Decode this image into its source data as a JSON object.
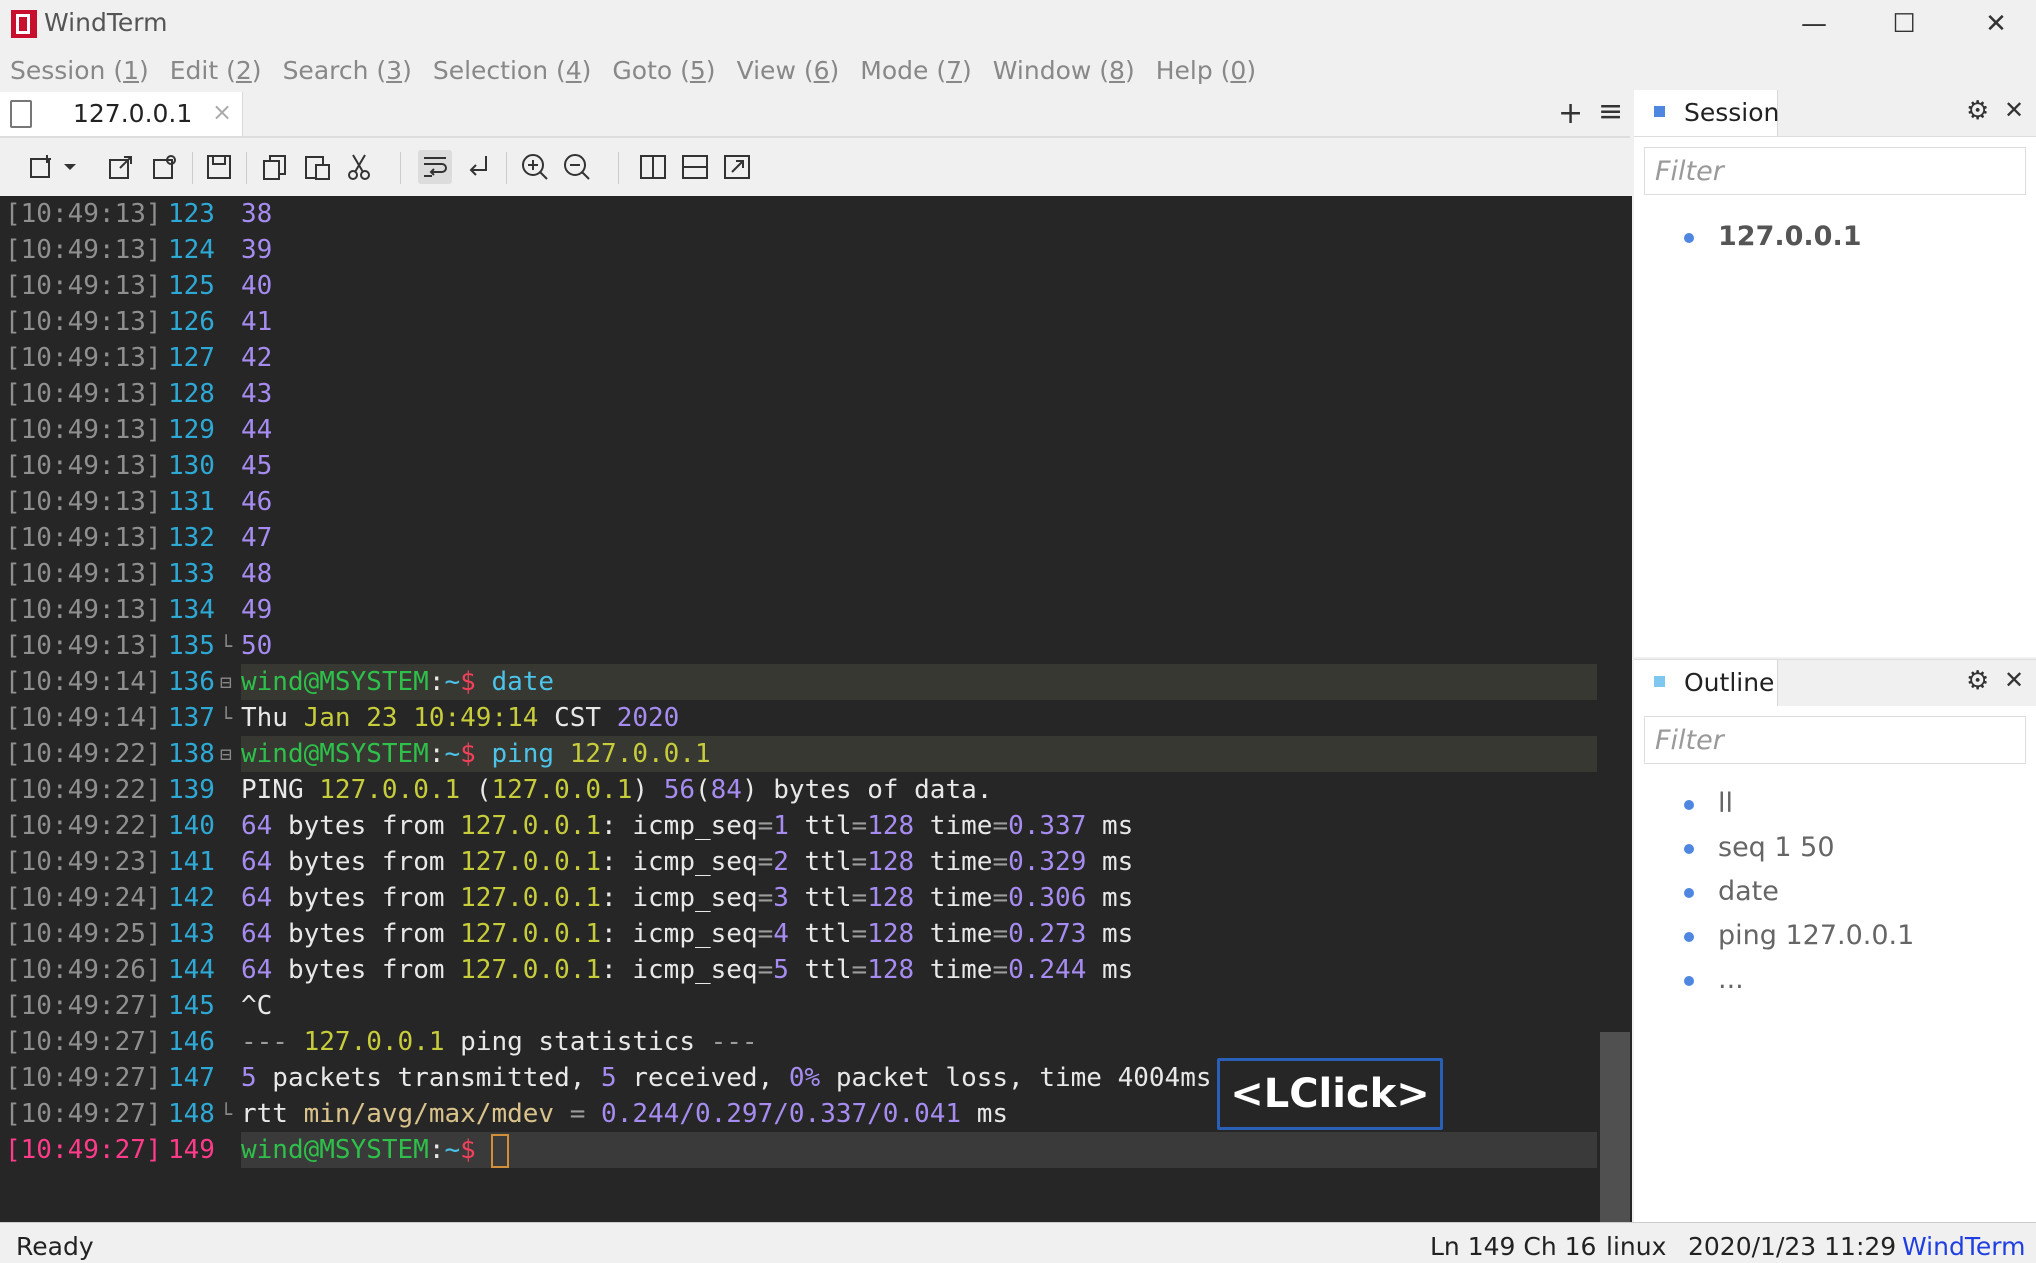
{
  "window": {
    "title": "WindTerm"
  },
  "menu": [
    {
      "label": "Session",
      "key": "1"
    },
    {
      "label": "Edit",
      "key": "2"
    },
    {
      "label": "Search",
      "key": "3"
    },
    {
      "label": "Selection",
      "key": "4"
    },
    {
      "label": "Goto",
      "key": "5"
    },
    {
      "label": "View",
      "key": "6"
    },
    {
      "label": "Mode",
      "key": "7"
    },
    {
      "label": "Window",
      "key": "8"
    },
    {
      "label": "Help",
      "key": "0"
    }
  ],
  "tab": {
    "label": "127.0.0.1",
    "close": "×"
  },
  "tabbar": {
    "add": "+",
    "menu": "≡"
  },
  "terminal": {
    "lines": [
      {
        "ts": "[10:49:13]",
        "ln": "123",
        "segs": [
          {
            "t": "38",
            "c": "c-num"
          }
        ]
      },
      {
        "ts": "[10:49:13]",
        "ln": "124",
        "segs": [
          {
            "t": "39",
            "c": "c-num"
          }
        ]
      },
      {
        "ts": "[10:49:13]",
        "ln": "125",
        "segs": [
          {
            "t": "40",
            "c": "c-num"
          }
        ]
      },
      {
        "ts": "[10:49:13]",
        "ln": "126",
        "segs": [
          {
            "t": "41",
            "c": "c-num"
          }
        ]
      },
      {
        "ts": "[10:49:13]",
        "ln": "127",
        "segs": [
          {
            "t": "42",
            "c": "c-num"
          }
        ]
      },
      {
        "ts": "[10:49:13]",
        "ln": "128",
        "segs": [
          {
            "t": "43",
            "c": "c-num"
          }
        ]
      },
      {
        "ts": "[10:49:13]",
        "ln": "129",
        "segs": [
          {
            "t": "44",
            "c": "c-num"
          }
        ]
      },
      {
        "ts": "[10:49:13]",
        "ln": "130",
        "segs": [
          {
            "t": "45",
            "c": "c-num"
          }
        ]
      },
      {
        "ts": "[10:49:13]",
        "ln": "131",
        "segs": [
          {
            "t": "46",
            "c": "c-num"
          }
        ]
      },
      {
        "ts": "[10:49:13]",
        "ln": "132",
        "segs": [
          {
            "t": "47",
            "c": "c-num"
          }
        ]
      },
      {
        "ts": "[10:49:13]",
        "ln": "133",
        "segs": [
          {
            "t": "48",
            "c": "c-num"
          }
        ]
      },
      {
        "ts": "[10:49:13]",
        "ln": "134",
        "segs": [
          {
            "t": "49",
            "c": "c-num"
          }
        ]
      },
      {
        "ts": "[10:49:13]",
        "ln": "135",
        "fold": "└",
        "segs": [
          {
            "t": "50",
            "c": "c-num"
          }
        ]
      },
      {
        "ts": "[10:49:14]",
        "ln": "136",
        "fold": "⊟",
        "prompt": true,
        "segs": [
          {
            "t": "wind@MSYSTEM",
            "c": "c-green"
          },
          {
            "t": ":",
            "c": "c-white"
          },
          {
            "t": "~",
            "c": "c-cyan"
          },
          {
            "t": "$ ",
            "c": "c-red"
          },
          {
            "t": "date",
            "c": "c-cyan"
          }
        ]
      },
      {
        "ts": "[10:49:14]",
        "ln": "137",
        "fold": "└",
        "segs": [
          {
            "t": "Thu ",
            "c": "c-white"
          },
          {
            "t": "Jan 23 10:49:14",
            "c": "c-yellow"
          },
          {
            "t": " CST ",
            "c": "c-white"
          },
          {
            "t": "2020",
            "c": "c-num"
          }
        ]
      },
      {
        "ts": "[10:49:22]",
        "ln": "138",
        "fold": "⊟",
        "prompt": true,
        "segs": [
          {
            "t": "wind@MSYSTEM",
            "c": "c-green"
          },
          {
            "t": ":",
            "c": "c-white"
          },
          {
            "t": "~",
            "c": "c-cyan"
          },
          {
            "t": "$ ",
            "c": "c-red"
          },
          {
            "t": "ping ",
            "c": "c-cyan"
          },
          {
            "t": "127.0.0.1",
            "c": "c-yellow"
          }
        ]
      },
      {
        "ts": "[10:49:22]",
        "ln": "139",
        "segs": [
          {
            "t": "PING ",
            "c": "c-white"
          },
          {
            "t": "127.0.0.1",
            "c": "c-yellow"
          },
          {
            "t": " (",
            "c": "c-white"
          },
          {
            "t": "127.0.0.1",
            "c": "c-yellow"
          },
          {
            "t": ") ",
            "c": "c-white"
          },
          {
            "t": "56",
            "c": "c-num"
          },
          {
            "t": "(",
            "c": "c-white"
          },
          {
            "t": "84",
            "c": "c-num"
          },
          {
            "t": ") bytes of data.",
            "c": "c-white"
          }
        ]
      },
      {
        "ts": "[10:49:22]",
        "ln": "140",
        "segs": [
          {
            "t": "64",
            "c": "c-num"
          },
          {
            "t": " bytes from ",
            "c": "c-white"
          },
          {
            "t": "127.0.0.1",
            "c": "c-yellow"
          },
          {
            "t": ": icmp_seq",
            "c": "c-white"
          },
          {
            "t": "=",
            "c": "c-gray"
          },
          {
            "t": "1",
            "c": "c-num"
          },
          {
            "t": " ttl",
            "c": "c-white"
          },
          {
            "t": "=",
            "c": "c-gray"
          },
          {
            "t": "128",
            "c": "c-num"
          },
          {
            "t": " time",
            "c": "c-white"
          },
          {
            "t": "=",
            "c": "c-gray"
          },
          {
            "t": "0.337",
            "c": "c-num"
          },
          {
            "t": " ms",
            "c": "c-white"
          }
        ]
      },
      {
        "ts": "[10:49:23]",
        "ln": "141",
        "segs": [
          {
            "t": "64",
            "c": "c-num"
          },
          {
            "t": " bytes from ",
            "c": "c-white"
          },
          {
            "t": "127.0.0.1",
            "c": "c-yellow"
          },
          {
            "t": ": icmp_seq",
            "c": "c-white"
          },
          {
            "t": "=",
            "c": "c-gray"
          },
          {
            "t": "2",
            "c": "c-num"
          },
          {
            "t": " ttl",
            "c": "c-white"
          },
          {
            "t": "=",
            "c": "c-gray"
          },
          {
            "t": "128",
            "c": "c-num"
          },
          {
            "t": " time",
            "c": "c-white"
          },
          {
            "t": "=",
            "c": "c-gray"
          },
          {
            "t": "0.329",
            "c": "c-num"
          },
          {
            "t": " ms",
            "c": "c-white"
          }
        ]
      },
      {
        "ts": "[10:49:24]",
        "ln": "142",
        "segs": [
          {
            "t": "64",
            "c": "c-num"
          },
          {
            "t": " bytes from ",
            "c": "c-white"
          },
          {
            "t": "127.0.0.1",
            "c": "c-yellow"
          },
          {
            "t": ": icmp_seq",
            "c": "c-white"
          },
          {
            "t": "=",
            "c": "c-gray"
          },
          {
            "t": "3",
            "c": "c-num"
          },
          {
            "t": " ttl",
            "c": "c-white"
          },
          {
            "t": "=",
            "c": "c-gray"
          },
          {
            "t": "128",
            "c": "c-num"
          },
          {
            "t": " time",
            "c": "c-white"
          },
          {
            "t": "=",
            "c": "c-gray"
          },
          {
            "t": "0.306",
            "c": "c-num"
          },
          {
            "t": " ms",
            "c": "c-white"
          }
        ]
      },
      {
        "ts": "[10:49:25]",
        "ln": "143",
        "segs": [
          {
            "t": "64",
            "c": "c-num"
          },
          {
            "t": " bytes from ",
            "c": "c-white"
          },
          {
            "t": "127.0.0.1",
            "c": "c-yellow"
          },
          {
            "t": ": icmp_seq",
            "c": "c-white"
          },
          {
            "t": "=",
            "c": "c-gray"
          },
          {
            "t": "4",
            "c": "c-num"
          },
          {
            "t": " ttl",
            "c": "c-white"
          },
          {
            "t": "=",
            "c": "c-gray"
          },
          {
            "t": "128",
            "c": "c-num"
          },
          {
            "t": " time",
            "c": "c-white"
          },
          {
            "t": "=",
            "c": "c-gray"
          },
          {
            "t": "0.273",
            "c": "c-num"
          },
          {
            "t": " ms",
            "c": "c-white"
          }
        ]
      },
      {
        "ts": "[10:49:26]",
        "ln": "144",
        "segs": [
          {
            "t": "64",
            "c": "c-num"
          },
          {
            "t": " bytes from ",
            "c": "c-white"
          },
          {
            "t": "127.0.0.1",
            "c": "c-yellow"
          },
          {
            "t": ": icmp_seq",
            "c": "c-white"
          },
          {
            "t": "=",
            "c": "c-gray"
          },
          {
            "t": "5",
            "c": "c-num"
          },
          {
            "t": " ttl",
            "c": "c-white"
          },
          {
            "t": "=",
            "c": "c-gray"
          },
          {
            "t": "128",
            "c": "c-num"
          },
          {
            "t": " time",
            "c": "c-white"
          },
          {
            "t": "=",
            "c": "c-gray"
          },
          {
            "t": "0.244",
            "c": "c-num"
          },
          {
            "t": " ms",
            "c": "c-white"
          }
        ]
      },
      {
        "ts": "[10:49:27]",
        "ln": "145",
        "segs": [
          {
            "t": "^C",
            "c": "c-white"
          }
        ]
      },
      {
        "ts": "[10:49:27]",
        "ln": "146",
        "segs": [
          {
            "t": "--- ",
            "c": "c-gray"
          },
          {
            "t": "127.0.0.1",
            "c": "c-yellow"
          },
          {
            "t": " ping statistics ",
            "c": "c-white"
          },
          {
            "t": "---",
            "c": "c-gray"
          }
        ]
      },
      {
        "ts": "[10:49:27]",
        "ln": "147",
        "segs": [
          {
            "t": "5",
            "c": "c-num"
          },
          {
            "t": " packets transmitted, ",
            "c": "c-white"
          },
          {
            "t": "5",
            "c": "c-num"
          },
          {
            "t": " received, ",
            "c": "c-white"
          },
          {
            "t": "0%",
            "c": "c-num"
          },
          {
            "t": " packet loss, time 4004ms",
            "c": "c-white"
          }
        ]
      },
      {
        "ts": "[10:49:27]",
        "ln": "148",
        "fold": "└",
        "segs": [
          {
            "t": "rtt ",
            "c": "c-white"
          },
          {
            "t": "min/avg/max/mdev",
            "c": "c-sand"
          },
          {
            "t": " = ",
            "c": "c-gray"
          },
          {
            "t": "0.244/0.297/0.337/0.041",
            "c": "c-num"
          },
          {
            "t": " ms",
            "c": "c-white"
          }
        ]
      },
      {
        "ts": "[10:49:27]",
        "ln": "149",
        "current": true,
        "prompt": true,
        "cursor": true,
        "segs": [
          {
            "t": "wind@MSYSTEM",
            "c": "c-green"
          },
          {
            "t": ":",
            "c": "c-white"
          },
          {
            "t": "~",
            "c": "c-cyan"
          },
          {
            "t": "$ ",
            "c": "c-red"
          }
        ]
      }
    ]
  },
  "overlay": {
    "lclick": "<LClick>"
  },
  "session_panel": {
    "title": "Session",
    "filter_placeholder": "Filter",
    "items": [
      "127.0.0.1"
    ]
  },
  "outline_panel": {
    "title": "Outline",
    "filter_placeholder": "Filter",
    "items": [
      "ll",
      "seq 1 50",
      "date",
      "ping 127.0.0.1",
      "..."
    ]
  },
  "status": {
    "state": "Ready",
    "position": "Ln 149 Ch 16",
    "os": "linux",
    "datetime": "2020/1/23 11:29",
    "brand": "WindTerm"
  },
  "colors": {
    "accent": "#1f3fe0",
    "terminal_bg": "#262626",
    "session_dot": "#4f86e0",
    "outline_dot": "#7ec8f0"
  }
}
